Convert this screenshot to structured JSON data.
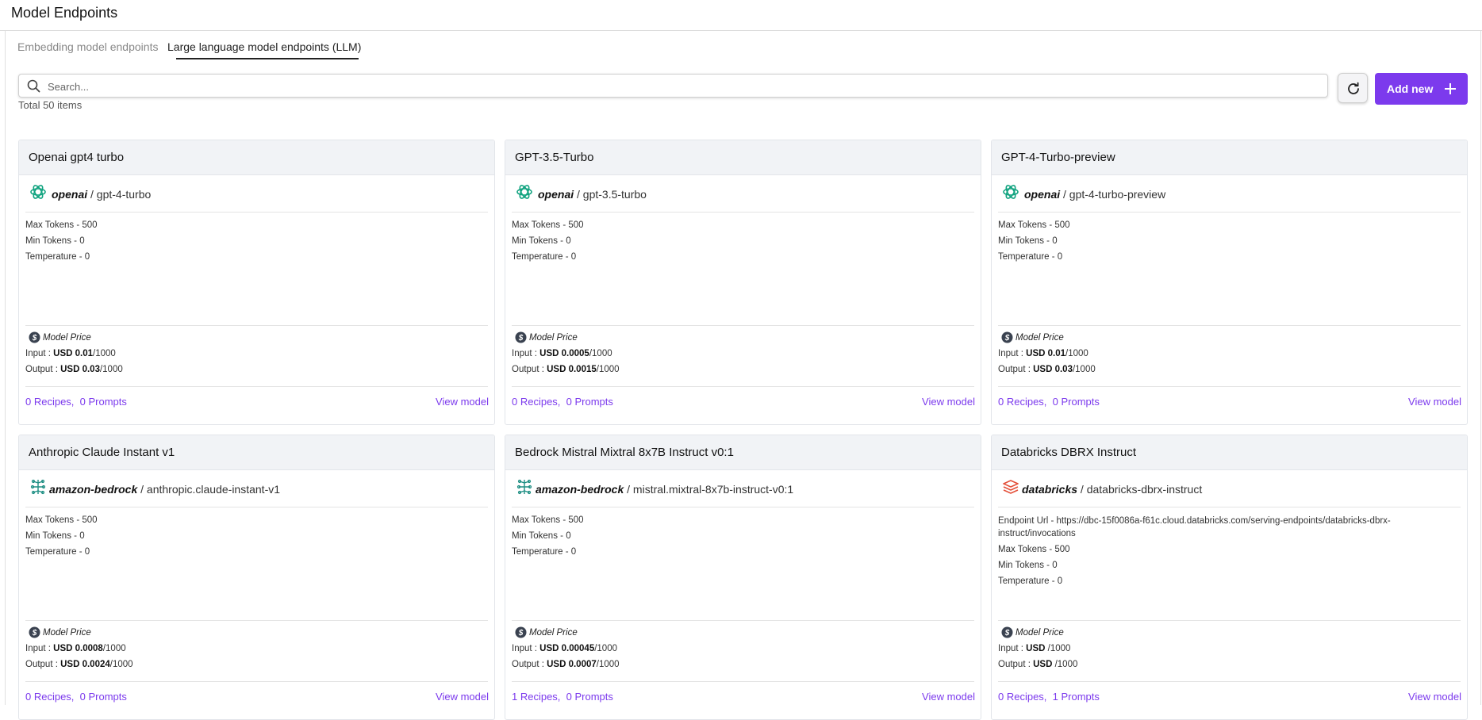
{
  "page": {
    "title": "Model Endpoints"
  },
  "tabs": [
    {
      "label": "Embedding model endpoints",
      "active": false
    },
    {
      "label": "Large language model endpoints (LLM)",
      "active": true
    }
  ],
  "search": {
    "placeholder": "Search..."
  },
  "toolbar": {
    "add_label": "Add new"
  },
  "total": "Total 50 items",
  "labels": {
    "model_price": "Model Price",
    "input": "Input : ",
    "output": "Output : ",
    "view_model": "View model",
    "max_tokens": "Max Tokens - ",
    "min_tokens": "Min Tokens - ",
    "temperature": "Temperature - ",
    "endpoint_url": "Endpoint Url - ",
    "per": "/1000"
  },
  "colors": {
    "accent": "#7c3aed",
    "header_bg": "#f1f3f6",
    "openai_icon": "#10a37f",
    "bedrock_icon": "#1f8f84",
    "databricks_icon": "#e4503a"
  },
  "cards": [
    {
      "title": "Openai gpt4 turbo",
      "provider": "openai",
      "provider_icon": "openai-icon",
      "model": "gpt-4-turbo",
      "endpoint_url": "",
      "max_tokens": "500",
      "min_tokens": "0",
      "temperature": "0",
      "input_price": "USD 0.01",
      "output_price": "USD 0.03",
      "recipes": "0 Recipes,",
      "prompts": "0 Prompts"
    },
    {
      "title": "GPT-3.5-Turbo",
      "provider": "openai",
      "provider_icon": "openai-icon",
      "model": "gpt-3.5-turbo",
      "endpoint_url": "",
      "max_tokens": "500",
      "min_tokens": "0",
      "temperature": "0",
      "input_price": "USD 0.0005",
      "output_price": "USD 0.0015",
      "recipes": "0 Recipes,",
      "prompts": "0 Prompts"
    },
    {
      "title": "GPT-4-Turbo-preview",
      "provider": "openai",
      "provider_icon": "openai-icon",
      "model": "gpt-4-turbo-preview",
      "endpoint_url": "",
      "max_tokens": "500",
      "min_tokens": "0",
      "temperature": "0",
      "input_price": "USD 0.01",
      "output_price": "USD 0.03",
      "recipes": "0 Recipes,",
      "prompts": "0 Prompts"
    },
    {
      "title": "Anthropic Claude Instant v1",
      "provider": "amazon-bedrock",
      "provider_icon": "bedrock-icon",
      "model": "anthropic.claude-instant-v1",
      "endpoint_url": "",
      "max_tokens": "500",
      "min_tokens": "0",
      "temperature": "0",
      "input_price": "USD 0.0008",
      "output_price": "USD 0.0024",
      "recipes": "0 Recipes,",
      "prompts": "0 Prompts"
    },
    {
      "title": "Bedrock Mistral Mixtral 8x7B Instruct v0:1",
      "provider": "amazon-bedrock",
      "provider_icon": "bedrock-icon",
      "model": "mistral.mixtral-8x7b-instruct-v0:1",
      "endpoint_url": "",
      "max_tokens": "500",
      "min_tokens": "0",
      "temperature": "0",
      "input_price": "USD 0.00045",
      "output_price": "USD 0.0007",
      "recipes": "1 Recipes,",
      "prompts": "0 Prompts"
    },
    {
      "title": "Databricks DBRX Instruct",
      "provider": "databricks",
      "provider_icon": "databricks-icon",
      "model": "databricks-dbrx-instruct",
      "endpoint_url": "https://dbc-15f0086a-f61c.cloud.databricks.com/serving-endpoints/databricks-dbrx-instruct/invocations",
      "max_tokens": "500",
      "min_tokens": "0",
      "temperature": "0",
      "input_price": "USD ",
      "output_price": "USD ",
      "recipes": "0 Recipes,",
      "prompts": "1 Prompts"
    }
  ]
}
